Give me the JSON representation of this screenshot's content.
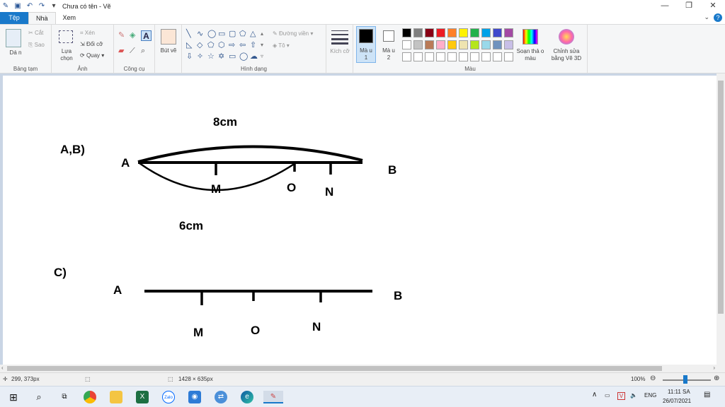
{
  "window": {
    "title": "Chưa có tên - Vẽ",
    "minimize": "—",
    "restore": "❐",
    "close": "✕"
  },
  "tabs": [
    "Tệp",
    "Nhà",
    "Xem"
  ],
  "help_glyph": "?",
  "ribbon": {
    "clipboard": {
      "paste": "Dá n",
      "cut": "Cắt",
      "copy": "Sao",
      "label": "Bảng tạm"
    },
    "image": {
      "select": "Lựa chọn",
      "crop": "Xén",
      "resize": "Đổi cỡ",
      "rotate": "Quay",
      "label": "Ảnh"
    },
    "tools": {
      "label": "Công cụ"
    },
    "brushes": {
      "label": "Bút vẽ"
    },
    "shapes": {
      "outline": "Đường viền",
      "fill": "Tô",
      "label": "Hình dạng"
    },
    "size": {
      "label": "Kích cỡ"
    },
    "color1": {
      "label": "Mà u 1",
      "value": "#000000"
    },
    "color2": {
      "label": "Mà u 2",
      "value": "#ffffff"
    },
    "colors": {
      "label": "Màu",
      "edit": "Soạn thả o màu",
      "paint3d": "Chỉnh sửa bằng Vẽ 3D"
    },
    "palette_row1": [
      "#000000",
      "#7f7f7f",
      "#880015",
      "#ed1c24",
      "#ff7f27",
      "#fff200",
      "#22b14c",
      "#00a2e8",
      "#3f48cc",
      "#a349a4"
    ],
    "palette_row2": [
      "#ffffff",
      "#c3c3c3",
      "#b97a57",
      "#ffaec9",
      "#ffc90e",
      "#efe4b0",
      "#b5e61d",
      "#99d9ea",
      "#7092be",
      "#c8bfe7"
    ]
  },
  "drawing": {
    "labels": {
      "top_length": "8cm",
      "part_ab": "A,B)",
      "a1": "A",
      "b1": "B",
      "m1": "M",
      "o1": "O",
      "n1": "N",
      "bottom_length": "6cm",
      "part_c": "C)",
      "a2": "A",
      "b2": "B",
      "m2": "M",
      "o2": "O",
      "n2": "N"
    }
  },
  "status": {
    "cursor": "299, 373px",
    "size": "1428 × 635px",
    "zoom": "100%"
  },
  "taskbar": {
    "lang": "ENG",
    "time": "11:11 SA",
    "date": "26/07/2021"
  }
}
